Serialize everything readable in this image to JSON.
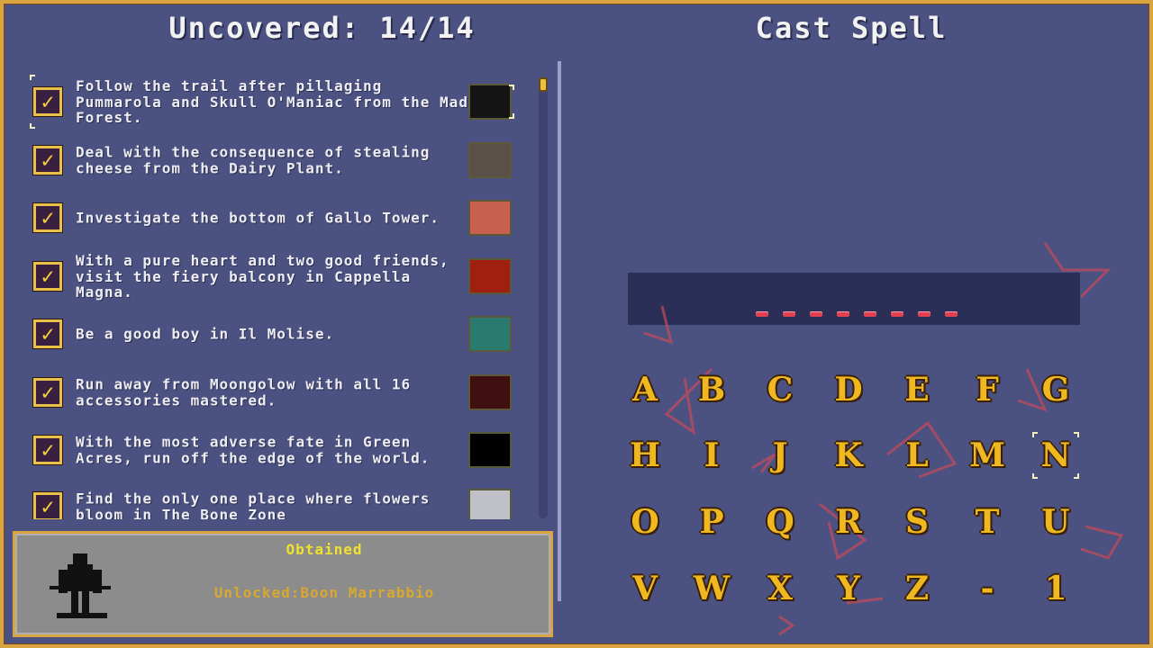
{
  "header": {
    "left_title": "Uncovered: 14/14",
    "right_title": "Cast Spell"
  },
  "secrets": [
    {
      "text": "Follow the trail after pillaging Pummarola and Skull O'Maniac from the Mad Forest.",
      "checked": true,
      "thumb": "#141414",
      "selected": true
    },
    {
      "text": "Deal with the consequence of stealing cheese from the Dairy Plant.",
      "checked": true,
      "thumb": "#5a5048"
    },
    {
      "text": "Investigate the bottom of Gallo Tower.",
      "checked": true,
      "thumb": "#c86050"
    },
    {
      "text": "With a pure heart and two good friends, visit the fiery balcony in Cappella Magna.",
      "checked": true,
      "thumb": "#a02010"
    },
    {
      "text": "Be a good boy in Il Molise.",
      "checked": true,
      "thumb": "#2a7a70"
    },
    {
      "text": "Run away from Moongolow with all 16 accessories mastered.",
      "checked": true,
      "thumb": "#401010"
    },
    {
      "text": "With the most adverse fate in Green Acres, run off the edge of the world.",
      "checked": true,
      "thumb": "#000000"
    },
    {
      "text": "Find the only one place where flowers bloom in The Bone Zone",
      "checked": true,
      "thumb": "#c0c0c8"
    }
  ],
  "check_glyph": "✓",
  "info": {
    "status": "Obtained",
    "reward": "Unlocked:Boon Marrabbio"
  },
  "spell": {
    "slots": 8,
    "entered": ""
  },
  "keyboard": {
    "rows": [
      [
        "A",
        "B",
        "C",
        "D",
        "E",
        "F",
        "G"
      ],
      [
        "H",
        "I",
        "J",
        "K",
        "L",
        "M",
        "N"
      ],
      [
        "O",
        "P",
        "Q",
        "R",
        "S",
        "T",
        "U"
      ],
      [
        "V",
        "W",
        "X",
        "Y",
        "Z",
        "-",
        "1"
      ]
    ],
    "selected": "N"
  },
  "colors": {
    "background": "#4b5180",
    "frame": "#d9a441",
    "key": "#f0b820",
    "dash": "#e04050",
    "obtained": "#f0e030",
    "reward": "#d8a830"
  }
}
